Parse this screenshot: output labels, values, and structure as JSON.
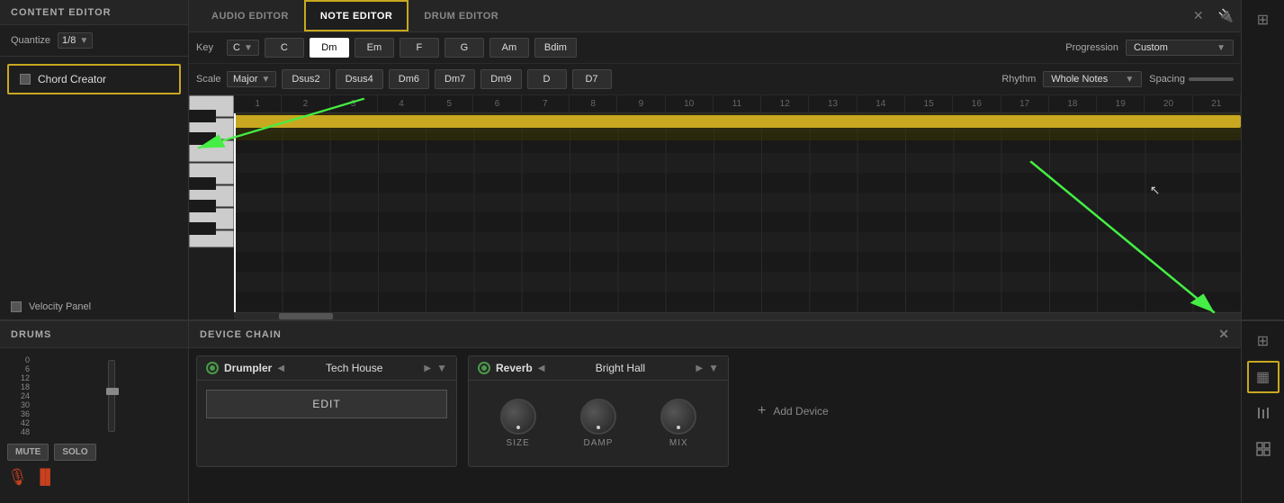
{
  "leftPanel": {
    "header": "CONTENT EDITOR",
    "quantize": {
      "label": "Quantize",
      "value": "1/8"
    },
    "chordCreator": {
      "label": "Chord Creator"
    },
    "velocityPanel": {
      "label": "Velocity Panel"
    }
  },
  "tabs": [
    {
      "label": "AUDIO EDITOR",
      "active": false
    },
    {
      "label": "NOTE EDITOR",
      "active": true
    },
    {
      "label": "DRUM EDITOR",
      "active": false
    }
  ],
  "chordRow": {
    "keyLabel": "Key",
    "keyValue": "C",
    "chords": [
      "C",
      "Dm",
      "Em",
      "F",
      "G",
      "Am",
      "Bdim"
    ],
    "activeChord": "Dm",
    "progression": {
      "label": "Progression",
      "value": "Custom"
    }
  },
  "scaleRow": {
    "scaleLabel": "Scale",
    "scaleValue": "Major",
    "chords": [
      "Dsus2",
      "Dsus4",
      "Dm6",
      "Dm7",
      "Dm9",
      "D",
      "D7"
    ],
    "rhythm": {
      "label": "Rhythm",
      "value": "Whole Notes"
    },
    "spacing": {
      "label": "Spacing"
    }
  },
  "gridNumbers": [
    "1",
    "2",
    "3",
    "4",
    "5",
    "6",
    "7",
    "8",
    "9",
    "10",
    "11",
    "12",
    "13",
    "14",
    "15",
    "16",
    "17",
    "18",
    "19",
    "20",
    "21"
  ],
  "drums": {
    "header": "DRUMS"
  },
  "deviceChain": {
    "header": "DEVICE CHAIN",
    "devices": [
      {
        "name": "Drumpler",
        "preset": "Tech House",
        "type": "instrument"
      },
      {
        "name": "Reverb",
        "preset": "Bright Hall",
        "type": "effect"
      }
    ],
    "addDevice": "Add Device"
  },
  "buttons": {
    "edit": "EDIT",
    "mute": "MUTE",
    "solo": "SOLO"
  },
  "knobs": {
    "size": "SIZE",
    "damp": "DAMP",
    "mix": "MIX"
  },
  "rightSidebar": {
    "gridIcon": "⊞",
    "deviceIcon": "▦",
    "mixerIcon": "|||"
  }
}
